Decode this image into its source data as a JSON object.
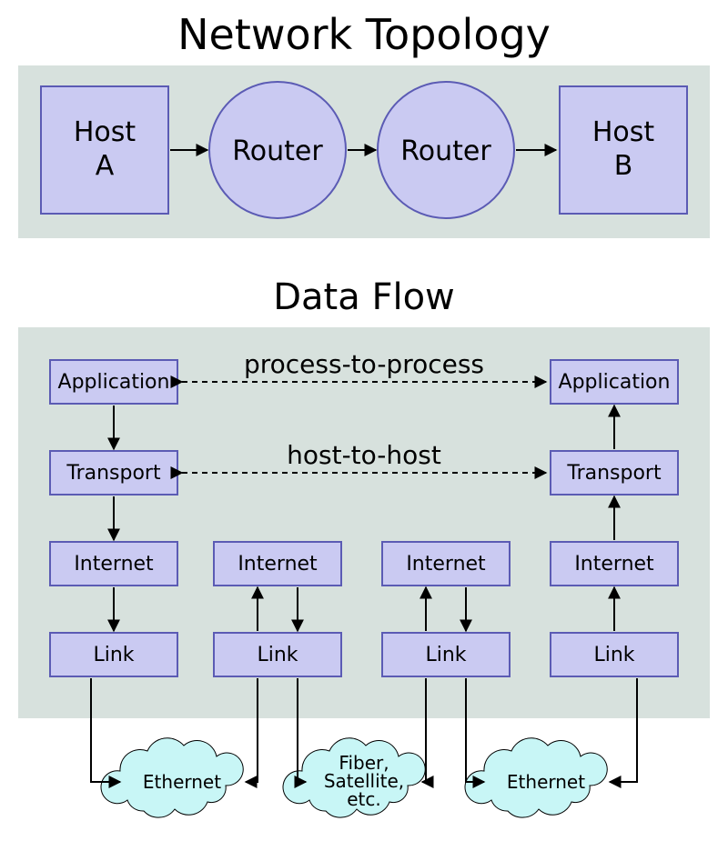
{
  "title": "Network Topology",
  "topology": {
    "hostA": {
      "line1": "Host",
      "line2": "A"
    },
    "router1": "Router",
    "router2": "Router",
    "hostB": {
      "line1": "Host",
      "line2": "B"
    }
  },
  "dataFlowTitle": "Data Flow",
  "layers": {
    "application": "Application",
    "transport": "Transport",
    "internet": "Internet",
    "link": "Link"
  },
  "logical": {
    "p2p": "process-to-process",
    "h2h": "host-to-host"
  },
  "media": {
    "eth1": "Ethernet",
    "fiber": {
      "line1": "Fiber,",
      "line2": "Satellite,",
      "line3": "etc."
    },
    "eth2": "Ethernet"
  },
  "colors": {
    "panel": "#d7e1dd",
    "nodeFill": "#cacaf2",
    "nodeStroke": "#5b5bb4",
    "cloud": "#c8f6f6"
  }
}
